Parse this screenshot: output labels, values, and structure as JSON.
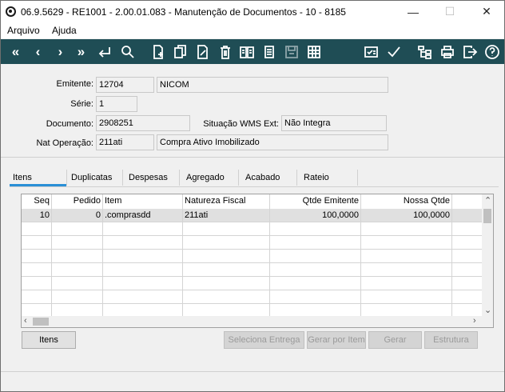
{
  "window": {
    "title": "06.9.5629 - RE1001 - 2.00.01.083 - Manutenção de Documentos - 10 - 8185",
    "minimize": "—",
    "maximize": "☐",
    "close": "✕"
  },
  "menu": {
    "arquivo": "Arquivo",
    "ajuda": "Ajuda"
  },
  "toolbar": {
    "background": "#1f4d55",
    "icons": [
      "first-icon",
      "prev-icon",
      "next-icon",
      "last-icon",
      "goto-icon",
      "search-icon",
      "new-doc-icon",
      "copy-icon",
      "edit-icon",
      "delete-icon",
      "book-icon",
      "notes-icon",
      "save-icon",
      "grid-icon",
      "checklist-icon",
      "confirm-icon",
      "tree-icon",
      "print-icon",
      "exit-icon",
      "help-icon"
    ]
  },
  "form": {
    "emitente_label": "Emitente:",
    "emitente_code": "12704",
    "emitente_name": "NICOM",
    "serie_label": "Série:",
    "serie": "1",
    "documento_label": "Documento:",
    "documento": "2908251",
    "situacao_label": "Situação WMS Ext:",
    "situacao": "Não Integra",
    "nat_label": "Nat Operação:",
    "nat_code": "211ati",
    "nat_desc": "Compra Ativo Imobilizado"
  },
  "tabs": [
    "Itens",
    "Duplicatas",
    "Despesas",
    "Agregado",
    "Acabado",
    "Rateio"
  ],
  "grid": {
    "headers": [
      "Seq",
      "Pedido",
      "Item",
      "Natureza Fiscal",
      "Qtde Emitente",
      "Nossa Qtde"
    ],
    "rows": [
      [
        "10",
        "0",
        ".comprasdd",
        "211ati",
        "100,0000",
        "100,0000"
      ]
    ],
    "selection_color": "#e0e0e0"
  },
  "buttons": {
    "itens": "Itens",
    "seleciona_entrega": "Seleciona Entrega",
    "gerar_por_item": "Gerar por Item",
    "gerar": "Gerar",
    "estrutura": "Estrutura"
  }
}
